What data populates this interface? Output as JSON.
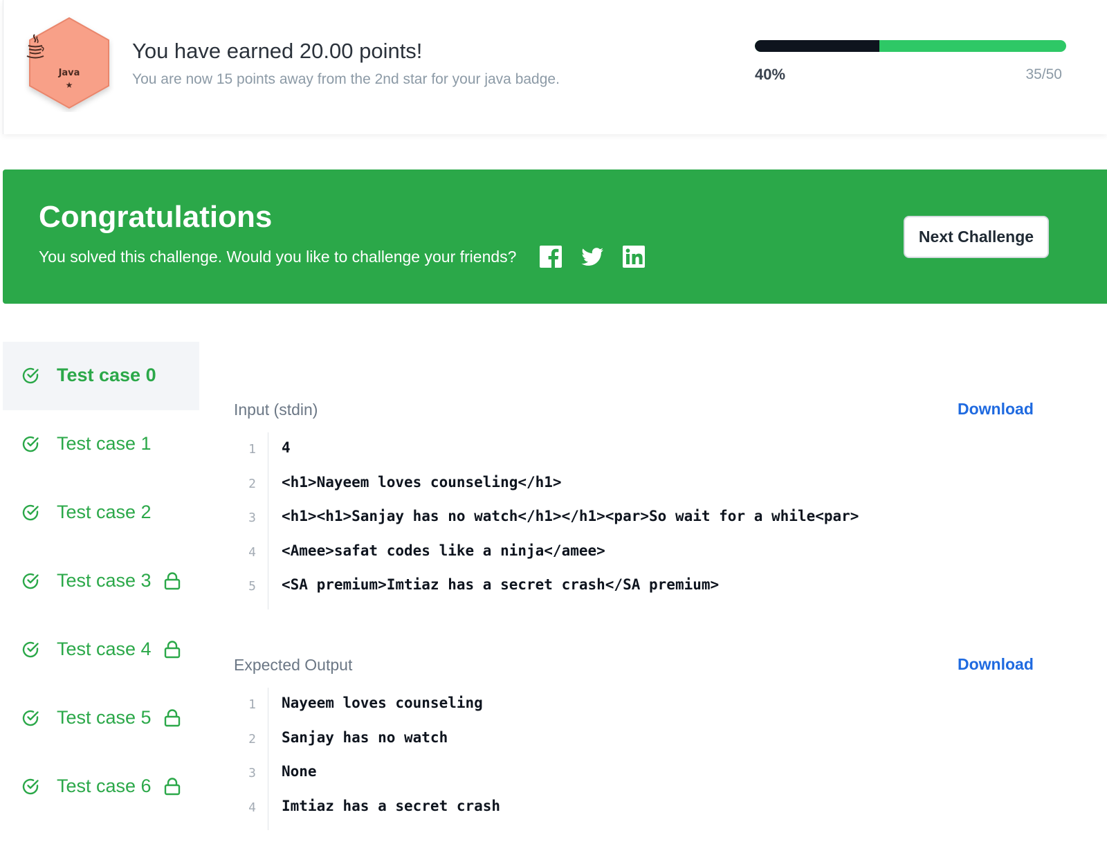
{
  "badge": {
    "language": "Java",
    "star": "★",
    "hex_color": "#f89f83",
    "icon": "java-cup-icon"
  },
  "points": {
    "title": "You have earned 20.00 points!",
    "subtitle": "You are now 15 points away from the 2nd star for your java badge."
  },
  "progress": {
    "percent_label": "40%",
    "count_label": "35/50",
    "fraction": 0.4,
    "fill_color": "#0e141e",
    "track_color": "#2ec866"
  },
  "banner": {
    "title": "Congratulations",
    "subtitle": "You solved this challenge. Would you like to challenge your friends?",
    "share_icons": [
      "facebook-icon",
      "twitter-icon",
      "linkedin-icon"
    ],
    "next_button": "Next Challenge",
    "background": "#2ba849"
  },
  "test_cases": [
    {
      "label": "Test case 0",
      "active": true,
      "locked": false
    },
    {
      "label": "Test case 1",
      "active": false,
      "locked": false
    },
    {
      "label": "Test case 2",
      "active": false,
      "locked": false
    },
    {
      "label": "Test case 3",
      "active": false,
      "locked": true
    },
    {
      "label": "Test case 4",
      "active": false,
      "locked": true
    },
    {
      "label": "Test case 5",
      "active": false,
      "locked": true
    },
    {
      "label": "Test case 6",
      "active": false,
      "locked": true
    }
  ],
  "input": {
    "heading": "Input (stdin)",
    "download": "Download",
    "lines": [
      {
        "num": "1",
        "text": "4"
      },
      {
        "num": "2",
        "text": "<h1>Nayeem loves counseling</h1>"
      },
      {
        "num": "3",
        "text": "<h1><h1>Sanjay has no watch</h1></h1><par>So wait for a while<par>"
      },
      {
        "num": "4",
        "text": "<Amee>safat codes like a ninja</amee>"
      },
      {
        "num": "5",
        "text": "<SA premium>Imtiaz has a secret crash</SA premium>"
      }
    ]
  },
  "expected": {
    "heading": "Expected Output",
    "download": "Download",
    "lines": [
      {
        "num": "1",
        "text": "Nayeem loves counseling"
      },
      {
        "num": "2",
        "text": "Sanjay has no watch"
      },
      {
        "num": "3",
        "text": "None"
      },
      {
        "num": "4",
        "text": "Imtiaz has a secret crash"
      }
    ]
  }
}
